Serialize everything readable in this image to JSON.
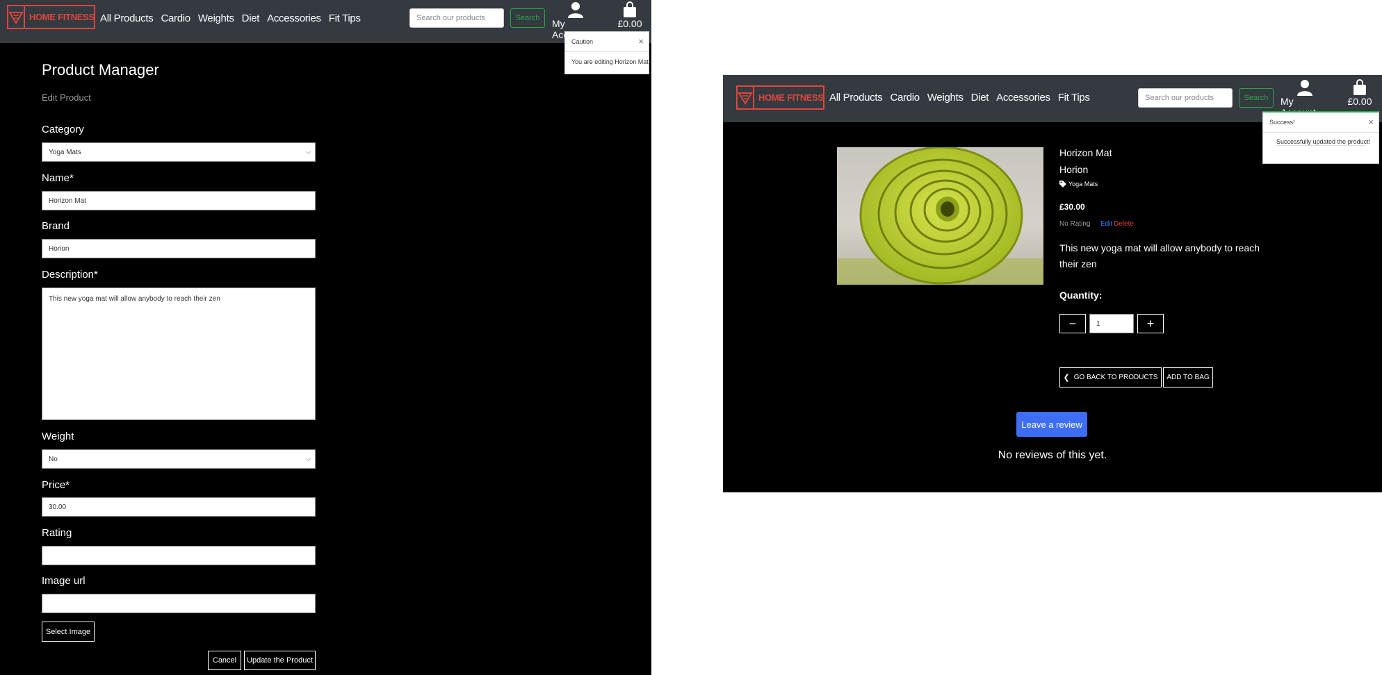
{
  "brand": {
    "name": "HOME FITNESS",
    "accent": "#e0453c"
  },
  "nav": {
    "links": [
      "All Products",
      "Cardio",
      "Weights",
      "Diet",
      "Accessories",
      "Fit Tips"
    ],
    "search_placeholder": "Search our products",
    "search_button": "Search",
    "account_label": "My Account",
    "bag_total": "£0.00"
  },
  "left": {
    "toast": {
      "title": "Caution",
      "message": "You are editing Horizon Mat",
      "close": "×"
    },
    "page_title": "Product Manager",
    "subtitle": "Edit Product",
    "form": {
      "category_label": "Category",
      "category_value": "Yoga Mats",
      "name_label": "Name*",
      "name_value": "Horizon Mat",
      "brand_label": "Brand",
      "brand_value": "Horion",
      "description_label": "Description*",
      "description_value": "This new yoga mat will allow anybody to reach their zen",
      "weight_label": "Weight",
      "weight_value": "No",
      "price_label": "Price*",
      "price_value": "30.00",
      "rating_label": "Rating",
      "rating_value": "",
      "image_url_label": "Image url",
      "image_url_value": "",
      "select_image_button": "Select Image",
      "cancel_button": "Cancel",
      "update_button": "Update the Product"
    }
  },
  "right": {
    "toast": {
      "title": "Success!",
      "message": "Successfully updated the product!",
      "close": "×"
    },
    "product": {
      "name": "Horizon Mat",
      "brand": "Horion",
      "category": "Yoga Mats",
      "price": "£30.00",
      "rating": "No Rating",
      "edit_link": "Edit",
      "delete_link": "Delete",
      "description": "This new yoga mat will allow anybody to reach their zen",
      "quantity_label": "Quantity:",
      "quantity_value": "1",
      "back_button": "GO BACK TO PRODUCTS",
      "add_to_bag_button": "ADD TO BAG",
      "review_button": "Leave a review",
      "no_reviews": "No reviews of this yet."
    },
    "colors": {
      "edit_link": "#3d7bff",
      "delete_link": "#e0453c",
      "review_button": "#3d6ef5",
      "success_border": "#28a745"
    }
  }
}
